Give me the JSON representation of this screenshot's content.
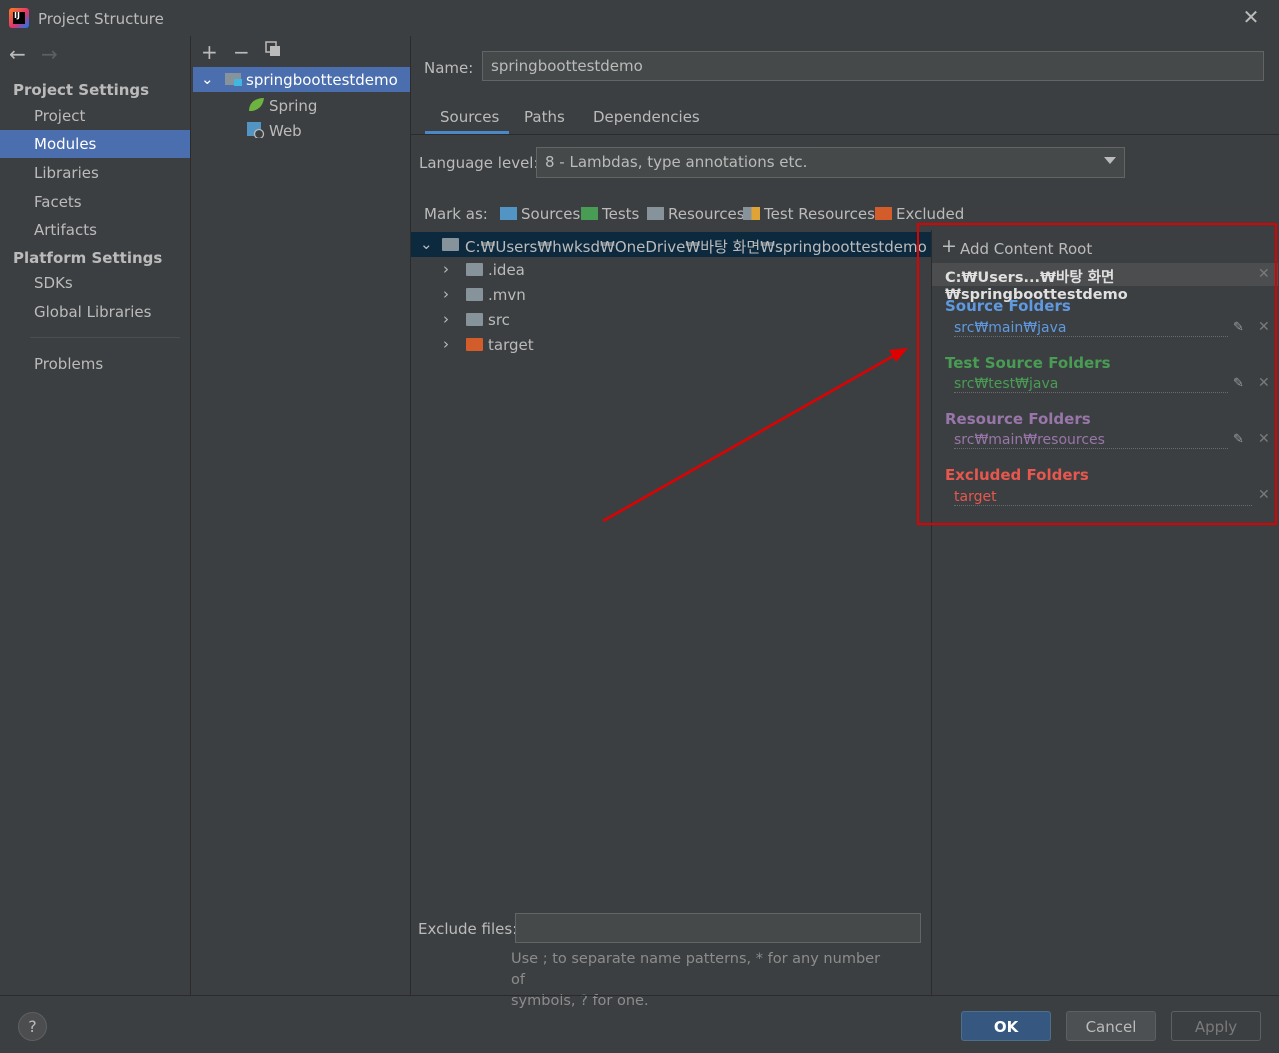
{
  "window": {
    "title": "Project Structure"
  },
  "nav": {
    "project_settings_header": "Project Settings",
    "project_settings_items": [
      "Project",
      "Modules",
      "Libraries",
      "Facets",
      "Artifacts"
    ],
    "selected": "Modules",
    "platform_settings_header": "Platform Settings",
    "platform_settings_items": [
      "SDKs",
      "Global Libraries"
    ],
    "problems": "Problems"
  },
  "module_tree": {
    "module": "springboottestdemo",
    "facets": [
      "Spring",
      "Web"
    ]
  },
  "main": {
    "name_label": "Name:",
    "name_value": "springboottestdemo",
    "tabs": [
      "Sources",
      "Paths",
      "Dependencies"
    ],
    "active_tab": "Sources",
    "language_level_label": "Language level:",
    "language_level_value": "8 - Lambdas, type annotations etc.",
    "mark_as_label": "Mark as:",
    "mark_as_buttons": [
      "Sources",
      "Tests",
      "Resources",
      "Test Resources",
      "Excluded"
    ],
    "tree": {
      "root": "C:₩Users₩hwksd₩OneDrive₩바탕 화면₩springboottestdemo",
      "children": [
        ".idea",
        ".mvn",
        "src",
        "target"
      ]
    },
    "exclude_files_label": "Exclude files:",
    "exclude_files_value": "",
    "exclude_hint_line1": "Use ; to separate name patterns, * for any number of",
    "exclude_hint_line2": "symbols, ? for one."
  },
  "content_roots": {
    "add_label": "Add Content Root",
    "root_header": "C:₩Users...₩바탕 화면₩springboottestdemo",
    "source_title": "Source Folders",
    "source_path": "src₩main₩java",
    "test_title": "Test Source Folders",
    "test_path": "src₩test₩java",
    "resource_title": "Resource Folders",
    "resource_path": "src₩main₩resources",
    "excluded_title": "Excluded Folders",
    "excluded_path": "target"
  },
  "colors": {
    "source": "#5f99e0",
    "test": "#499c54",
    "resource": "#9876aa",
    "excluded": "#e8574e",
    "selection": "#4b6eaf",
    "annotation": "#e00000"
  },
  "buttons": {
    "ok": "OK",
    "cancel": "Cancel",
    "apply": "Apply",
    "help": "?"
  }
}
